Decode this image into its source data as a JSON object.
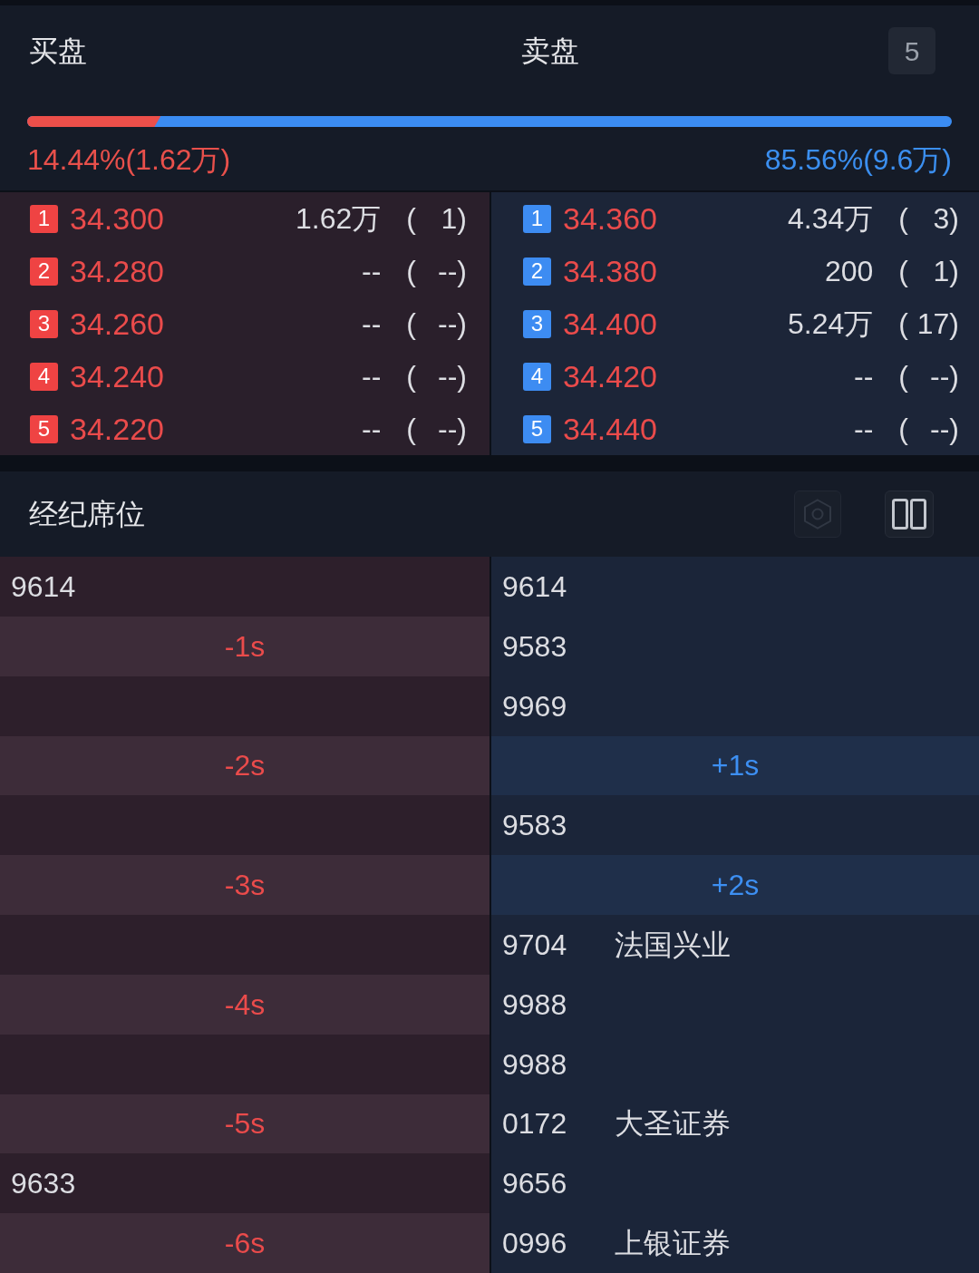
{
  "order_book": {
    "bid_title": "买盘",
    "ask_title": "卖盘",
    "depth_button": "5",
    "ratio_bar": {
      "level": 0.1444,
      "bid_label": "14.44%(1.62万)",
      "ask_label": "85.56%(9.6万)"
    },
    "bids": [
      {
        "rank": "1",
        "price": "34.300",
        "volume": "1.62万",
        "paren": "(",
        "orders": "1)"
      },
      {
        "rank": "2",
        "price": "34.280",
        "volume": "--",
        "paren": "(",
        "orders": "--)"
      },
      {
        "rank": "3",
        "price": "34.260",
        "volume": "--",
        "paren": "(",
        "orders": "--)"
      },
      {
        "rank": "4",
        "price": "34.240",
        "volume": "--",
        "paren": "(",
        "orders": "--)"
      },
      {
        "rank": "5",
        "price": "34.220",
        "volume": "--",
        "paren": "(",
        "orders": "--)"
      }
    ],
    "asks": [
      {
        "rank": "1",
        "price": "34.360",
        "volume": "4.34万",
        "paren": "(",
        "orders": "3)"
      },
      {
        "rank": "2",
        "price": "34.380",
        "volume": "200",
        "paren": "(",
        "orders": "1)"
      },
      {
        "rank": "3",
        "price": "34.400",
        "volume": "5.24万",
        "paren": "(",
        "orders": "17)"
      },
      {
        "rank": "4",
        "price": "34.420",
        "volume": "--",
        "paren": "(",
        "orders": "--)"
      },
      {
        "rank": "5",
        "price": "34.440",
        "volume": "--",
        "paren": "(",
        "orders": "--)"
      }
    ]
  },
  "broker_queue": {
    "title": "经纪席位",
    "tools": [
      {
        "kind": "hexagon",
        "disabled": true
      },
      {
        "kind": "columns",
        "disabled": false
      }
    ],
    "buy_side": [
      {
        "kind": "broker",
        "code": "9614"
      },
      {
        "kind": "spread",
        "label": "-1s"
      },
      {
        "kind": "empty"
      },
      {
        "kind": "spread",
        "label": "-2s"
      },
      {
        "kind": "empty"
      },
      {
        "kind": "spread",
        "label": "-3s"
      },
      {
        "kind": "empty"
      },
      {
        "kind": "spread",
        "label": "-4s"
      },
      {
        "kind": "empty"
      },
      {
        "kind": "spread",
        "label": "-5s"
      },
      {
        "kind": "broker",
        "code": "9633"
      },
      {
        "kind": "spread",
        "label": "-6s"
      }
    ],
    "sell_side": [
      {
        "kind": "broker",
        "code": "9614"
      },
      {
        "kind": "broker",
        "code": "9583"
      },
      {
        "kind": "broker",
        "code": "9969"
      },
      {
        "kind": "spread",
        "label": "+1s"
      },
      {
        "kind": "broker",
        "code": "9583"
      },
      {
        "kind": "spread",
        "label": "+2s"
      },
      {
        "kind": "broker",
        "code": "9704",
        "name": "法国兴业"
      },
      {
        "kind": "broker",
        "code": "9988"
      },
      {
        "kind": "broker",
        "code": "9988"
      },
      {
        "kind": "broker",
        "code": "0172",
        "name": "大圣证券"
      },
      {
        "kind": "broker",
        "code": "9656"
      },
      {
        "kind": "broker",
        "code": "0996",
        "name": "上银证券"
      }
    ]
  }
}
